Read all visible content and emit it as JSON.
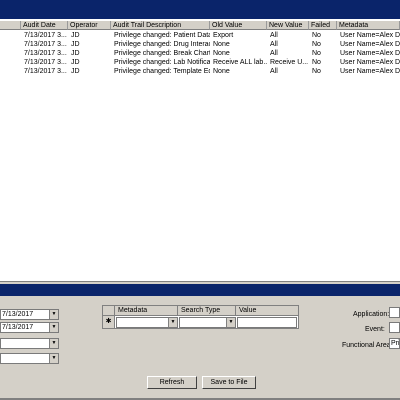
{
  "audit_table": {
    "columns": [
      "Audit Date",
      "Operator",
      "Audit Trail Description",
      "Old Value",
      "New Value",
      "Failed",
      "Metadata"
    ],
    "rows": [
      {
        "date": "7/13/2017 3...",
        "operator": "JD",
        "description": "Privilege changed: Patient Data ...",
        "old": "Export",
        "new": "All",
        "failed": "No",
        "metadata": "User Name=Alex Doe"
      },
      {
        "date": "7/13/2017 3...",
        "operator": "JD",
        "description": "Privilege changed: Drug Interact...",
        "old": "None",
        "new": "All",
        "failed": "No",
        "metadata": "User Name=Alex Doe"
      },
      {
        "date": "7/13/2017 3...",
        "operator": "JD",
        "description": "Privilege changed: Break Chart ...",
        "old": "None",
        "new": "All",
        "failed": "No",
        "metadata": "User Name=Alex Doe"
      },
      {
        "date": "7/13/2017 3...",
        "operator": "JD",
        "description": "Privilege changed: Lab Notificati...",
        "old": "Receive ALL lab...",
        "new": "Receive U...",
        "failed": "No",
        "metadata": "User Name=Alex Doe"
      },
      {
        "date": "7/13/2017 3...",
        "operator": "JD",
        "description": "Privilege changed: Template Edi...",
        "old": "None",
        "new": "All",
        "failed": "No",
        "metadata": "User Name=Alex Doe"
      }
    ]
  },
  "filters": {
    "start_date": "7/13/2017",
    "end_date": "7/13/2017",
    "combo3": "",
    "combo4": ""
  },
  "metadata_grid": {
    "columns": [
      "Metadata",
      "Search Type",
      "Value"
    ],
    "new_row_marker": "✱"
  },
  "right_filters": {
    "application_label": "Application:",
    "event_label": "Event:",
    "functional_area_label": "Functional Area:",
    "functional_area_value": "Priv"
  },
  "buttons": {
    "refresh": "Refresh",
    "save_to_file": "Save to File"
  },
  "colors": {
    "title_bar": "#0a246a",
    "face": "#d4d0c8"
  }
}
